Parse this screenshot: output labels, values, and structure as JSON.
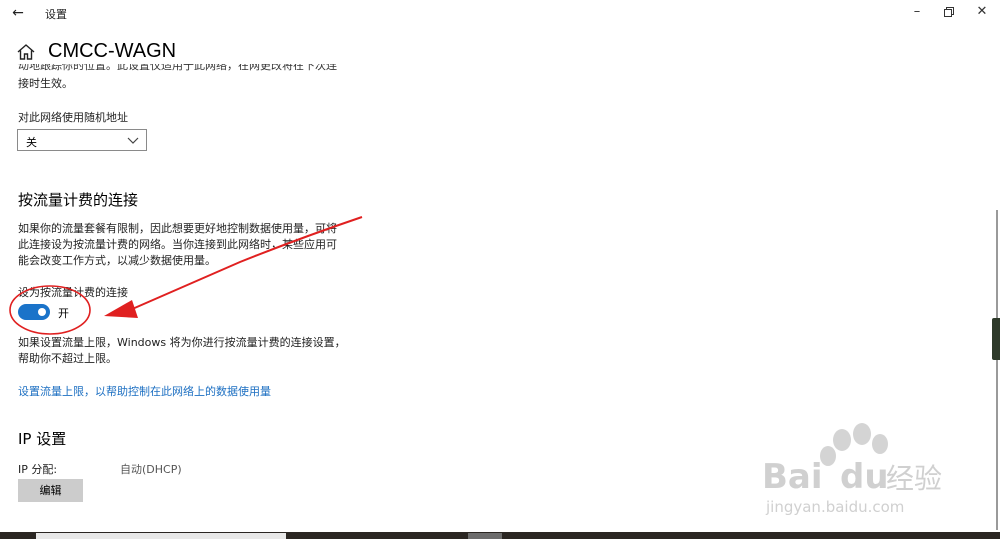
{
  "window": {
    "back_icon": "arrow-left-icon",
    "app_title": "设置",
    "minimize_icon": "minimize-icon",
    "maximize_icon": "restore-icon",
    "close_icon": "close-icon"
  },
  "page": {
    "home_icon": "home-icon",
    "title": "CMCC-WAGN"
  },
  "random_address": {
    "intro_text_cut": "动地跟踪你的位置。此设置仅适用于此网络，在网更改将在下次连",
    "intro_text_tail": "接时生效。",
    "label": "对此网络使用随机地址",
    "select_value": "关"
  },
  "metered": {
    "heading": "按流量计费的连接",
    "description": [
      "如果你的流量套餐有限制，因此想要更好地控制数据使用量，可将",
      "此连接设为按流量计费的网络。当你连接到此网络时，某些应用可",
      "能会改变工作方式，以减少数据使用量。"
    ],
    "toggle_label": "设为按流量计费的连接",
    "toggle_state": "开",
    "toggle_on": true,
    "limit_text": [
      "如果设置流量上限，Windows 将为你进行按流量计费的连接设置，",
      "帮助你不超过上限。"
    ],
    "link_text": "设置流量上限，以帮助控制在此网络上的数据使用量"
  },
  "ip": {
    "heading": "IP 设置",
    "assignment_label": "IP 分配:",
    "assignment_value": "自动(DHCP)",
    "edit_button": "编辑"
  },
  "watermark": {
    "brand": "Bai",
    "brand2": "du",
    "suffix": "经验",
    "url": "jingyan.baidu.com"
  },
  "colors": {
    "accent": "#1a73c9",
    "link": "#1c6fc2",
    "annotation": "#e02020"
  }
}
